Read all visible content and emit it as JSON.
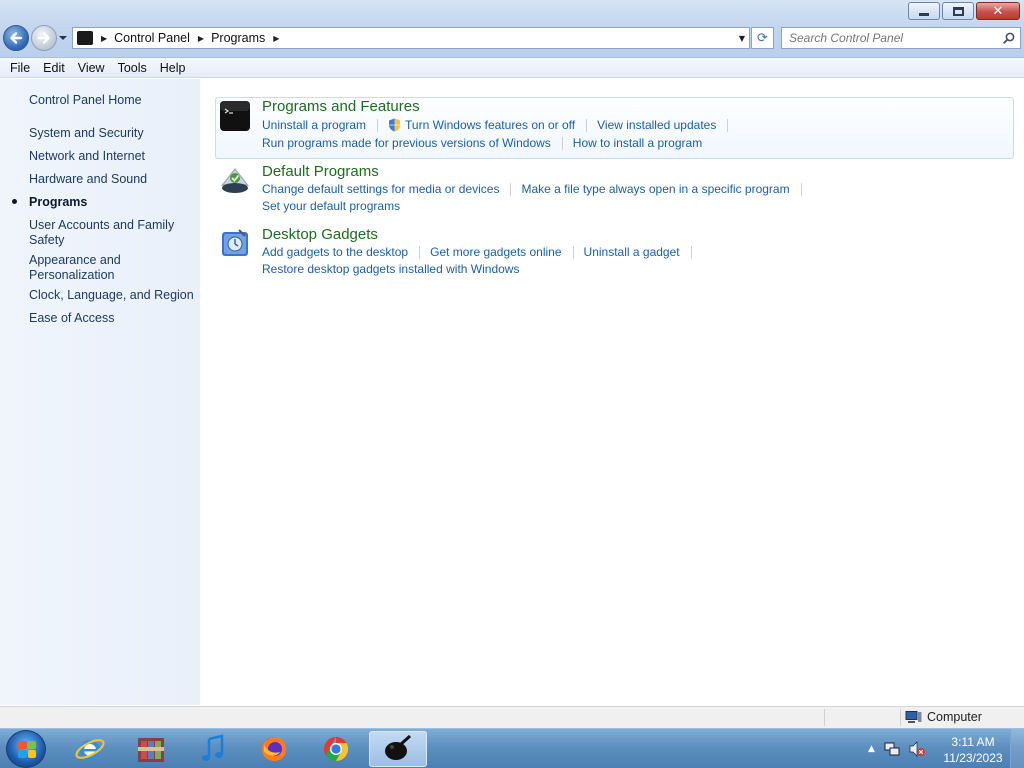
{
  "window": {
    "minimize_icon": "minimize-icon",
    "maximize_icon": "restore-icon",
    "close_icon": "close-icon",
    "close_glyph": "✕"
  },
  "address": {
    "crumbs": [
      "Control Panel",
      "Programs"
    ],
    "separator": "▶",
    "dropdown": "▼",
    "refresh": "⟳",
    "search_placeholder": "Search Control Panel"
  },
  "menu": [
    "File",
    "Edit",
    "View",
    "Tools",
    "Help"
  ],
  "sidebar": {
    "home": "Control Panel Home",
    "items": [
      "System and Security",
      "Network and Internet",
      "Hardware and Sound",
      "Programs",
      "User Accounts and Family Safety",
      "Appearance and Personalization",
      "Clock, Language, and Region",
      "Ease of Access"
    ],
    "active_item": "Programs"
  },
  "categories": [
    {
      "title": "Programs and Features",
      "icon": "programs-features-icon",
      "tasks_row1": [
        "Uninstall a program",
        "Turn Windows features on or off",
        "View installed updates"
      ],
      "tasks_row2": [
        "Run programs made for previous versions of Windows",
        "How to install a program"
      ]
    },
    {
      "title": "Default Programs",
      "icon": "default-programs-icon",
      "tasks_row1": [
        "Change default settings for media or devices",
        "Make a file type always open in a specific program"
      ],
      "tasks_row2": [
        "Set your default programs"
      ]
    },
    {
      "title": "Desktop Gadgets",
      "icon": "desktop-gadgets-icon",
      "tasks_row1": [
        "Add gadgets to the desktop",
        "Get more gadgets online",
        "Uninstall a gadget"
      ],
      "tasks_row2": [
        "Restore desktop gadgets installed with Windows"
      ]
    }
  ],
  "status": {
    "location": "Computer"
  },
  "taskbar": {
    "apps": [
      "internet-explorer",
      "archive-manager",
      "itunes",
      "firefox",
      "chrome",
      "control-panel"
    ],
    "active_app": "control-panel",
    "clock_time": "3:11 AM",
    "clock_date": "11/23/2023",
    "tray_arrow": "▲"
  },
  "colors": {
    "category_title": "#1e6c1e",
    "link": "#1a5fa8",
    "sidebar_bg": "#e9f0fa"
  }
}
